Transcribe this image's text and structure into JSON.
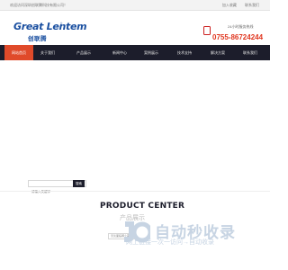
{
  "topbar": {
    "welcome": "欢迎访问深圳创联腾科技有限公司！",
    "link_favorite": "加入收藏",
    "link_contact": "联系我们"
  },
  "header": {
    "logo_en": "Great Lentem",
    "logo_reg": "®",
    "logo_cn": "创联腾",
    "hotline_label": "24小时服务热线",
    "hotline_number": "0755-86724244"
  },
  "nav": {
    "items": [
      {
        "label": "网站首页"
      },
      {
        "label": "关于我们"
      },
      {
        "label": "产品展示"
      },
      {
        "label": "新闻中心"
      },
      {
        "label": "案例展示"
      },
      {
        "label": "技术支持"
      },
      {
        "label": "解决方案"
      },
      {
        "label": "联系我们"
      }
    ]
  },
  "search": {
    "placeholder": "请输入关键字",
    "button": "搜索"
  },
  "product_center": {
    "title_en": "PRODUCT CENTER",
    "title_cn": "产品展示"
  },
  "mini_search": {
    "text": "无论面临哪个需求，可以..."
  },
  "watermark": {
    "text": "自动秒收录",
    "sub": "网上链接一次一访问→自动收录"
  },
  "colors": {
    "brand_blue": "#1a4fa0",
    "nav_dark": "#1c1d2b",
    "accent_red": "#e04a2a"
  }
}
